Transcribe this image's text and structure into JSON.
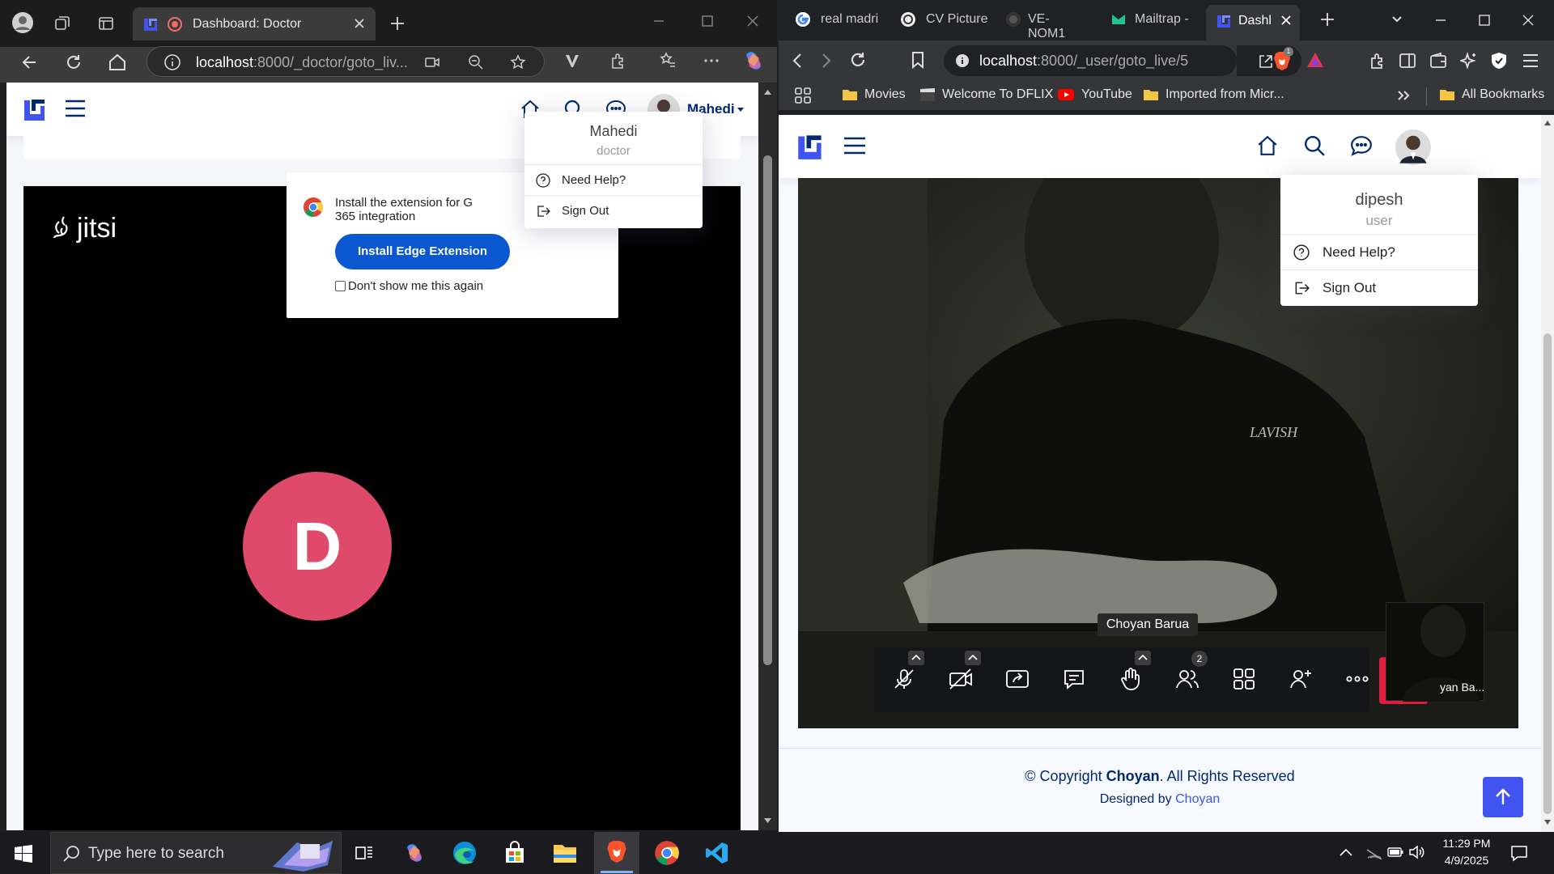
{
  "left_window": {
    "tab_title": "Dashboard: Doctor",
    "address": "localhost:8000/_doctor/goto_liv...",
    "address_host": "localhost",
    "address_rest": ":8000/_doctor/goto_liv...",
    "header": {
      "username": "Mahedi"
    },
    "dropdown": {
      "name": "Mahedi",
      "role": "doctor",
      "items": [
        {
          "label": "Need Help?"
        },
        {
          "label": "Sign Out"
        }
      ]
    },
    "jitsi": {
      "logo_text": "jitsi",
      "popup": {
        "text_line1": "Install the extension for G",
        "text_line2": "365 integration",
        "button_label": "Install Edge Extension",
        "checkbox_label": "Don't show me this again"
      },
      "avatar_letter": "D",
      "avatar_color": "#df4a6a"
    }
  },
  "right_window": {
    "tabs": [
      {
        "label": "real madri"
      },
      {
        "label": "CV Picture"
      },
      {
        "label": "VE-NOM1"
      },
      {
        "label": "Mailtrap -"
      },
      {
        "label": "Dashl"
      }
    ],
    "address_host": "localhost",
    "address_rest": ":8000/_user/goto_live/5",
    "bookmarks": [
      {
        "label": "Movies"
      },
      {
        "label": "Welcome To DFLIX"
      },
      {
        "label": "YouTube"
      },
      {
        "label": "Imported from Micr..."
      },
      {
        "label": "All Bookmarks"
      }
    ],
    "dropdown": {
      "name": "dipesh",
      "role": "user",
      "items": [
        {
          "label": "Need Help?"
        },
        {
          "label": "Sign Out"
        }
      ]
    },
    "video": {
      "shirt_text": "LAVISH",
      "participant_name": "Choyan Barua",
      "thumb_name": "yan Ba...",
      "participants_count": "2",
      "hangup_color": "#dd1e3c"
    },
    "footer": {
      "copyright_prefix": "© Copyright ",
      "copyright_brand": "Choyan",
      "copyright_suffix": ". All Rights Reserved",
      "designed_prefix": "Designed by ",
      "designed_link": "Choyan"
    }
  },
  "taskbar": {
    "search_placeholder": "Type here to search",
    "time": "11:29 PM",
    "date": "4/9/2025"
  },
  "colors": {
    "brand_navy": "#012970",
    "brand_blue": "#4154f1",
    "edge_button_blue": "#0b57d0"
  }
}
